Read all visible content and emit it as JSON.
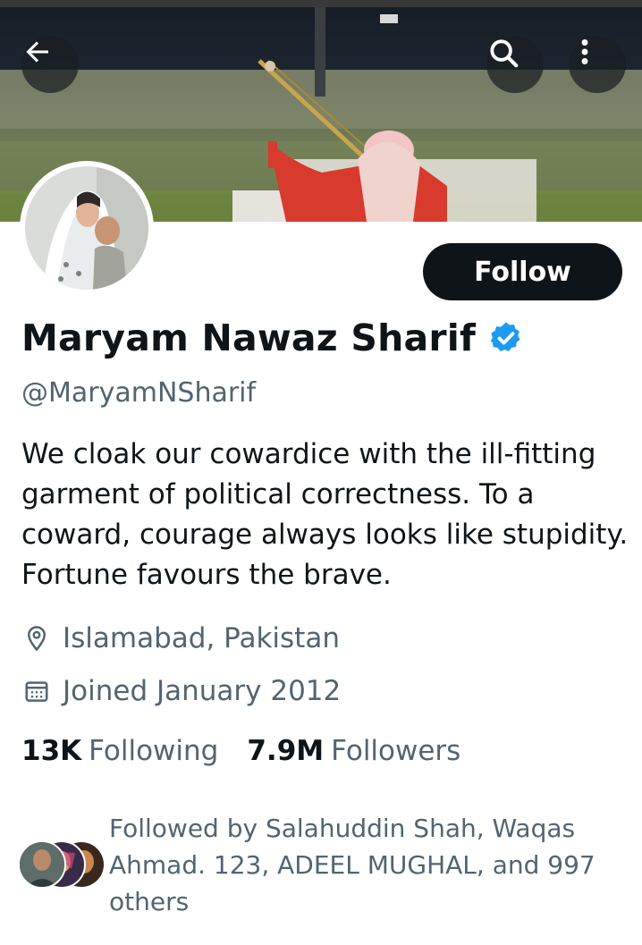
{
  "header": {
    "back_icon": "arrow-left-icon",
    "search_icon": "search-icon",
    "more_icon": "more-vertical-icon"
  },
  "profile": {
    "name": "Maryam Nawaz Sharif",
    "handle": "@MaryamNSharif",
    "verified_color": "#1d9bf0",
    "follow_label": "Follow",
    "bio": "We cloak our cowardice with the ill-fitting garment of political correctness. To a coward, courage always looks like stupidity. Fortune favours the brave.",
    "location": "Islamabad, Pakistan",
    "joined": "Joined January 2012",
    "following_count": "13K",
    "following_label": "Following",
    "followers_count": "7.9M",
    "followers_label": "Followers",
    "followed_by": "Followed by Salahuddin Shah, Waqas Ahmad. 123, ADEEL MUGHAL, and 997 others"
  },
  "colors": {
    "text_primary": "#0f1419",
    "text_secondary": "#536471",
    "button_bg": "#0f1419",
    "accent": "#1d9bf0"
  }
}
